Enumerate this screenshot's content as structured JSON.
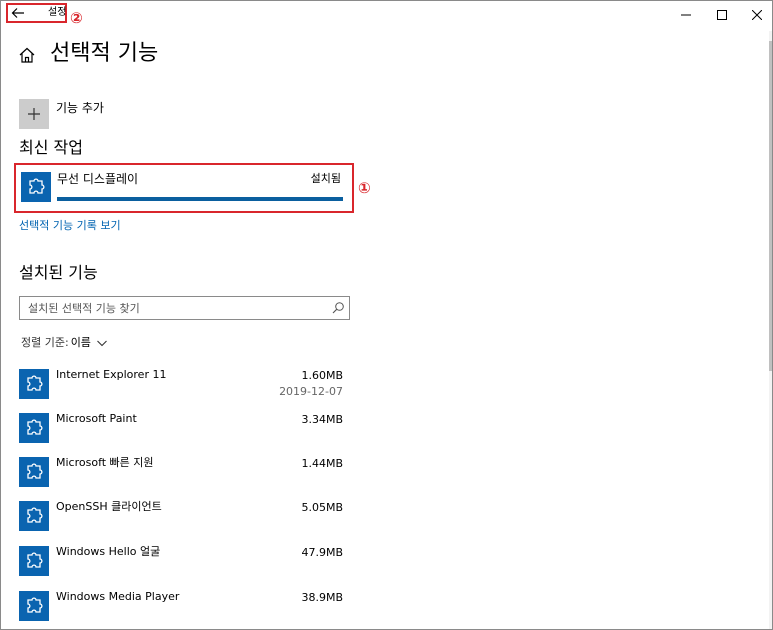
{
  "window": {
    "title": "설정",
    "annotation_back": "②",
    "annotation_recent": "①"
  },
  "page": {
    "title": "선택적 기능"
  },
  "add_feature": {
    "label": "기능 추가"
  },
  "recent": {
    "heading": "최신 작업",
    "item_name": "무선 디스플레이",
    "item_status": "설치됨",
    "progress_fraction": 1.0
  },
  "history_link": "선택적 기능 기록 보기",
  "installed": {
    "heading": "설치된 기능",
    "search_placeholder": "설치된 선택적 기능 찾기",
    "sort_label": "정렬 기준:",
    "sort_value": "이름",
    "items": [
      {
        "name": "Internet Explorer 11",
        "size": "1.60MB",
        "date": "2019-12-07"
      },
      {
        "name": "Microsoft Paint",
        "size": "3.34MB",
        "date": ""
      },
      {
        "name": "Microsoft 빠른 지원",
        "size": "1.44MB",
        "date": ""
      },
      {
        "name": "OpenSSH 클라이언트",
        "size": "5.05MB",
        "date": ""
      },
      {
        "name": "Windows Hello 얼굴",
        "size": "47.9MB",
        "date": ""
      },
      {
        "name": "Windows Media Player",
        "size": "38.9MB",
        "date": ""
      }
    ]
  },
  "colors": {
    "accent": "#0063b1",
    "tile": "#0a64b0",
    "progress": "#0a5f9f",
    "annotation": "#d9262c"
  },
  "icons": {
    "back": "back-arrow-icon",
    "home": "home-icon",
    "add": "plus-icon",
    "feature": "puzzle-icon",
    "search": "search-icon",
    "sort": "chevron-down-icon",
    "minimize": "minimize-icon",
    "maximize": "maximize-icon",
    "close": "close-icon"
  }
}
